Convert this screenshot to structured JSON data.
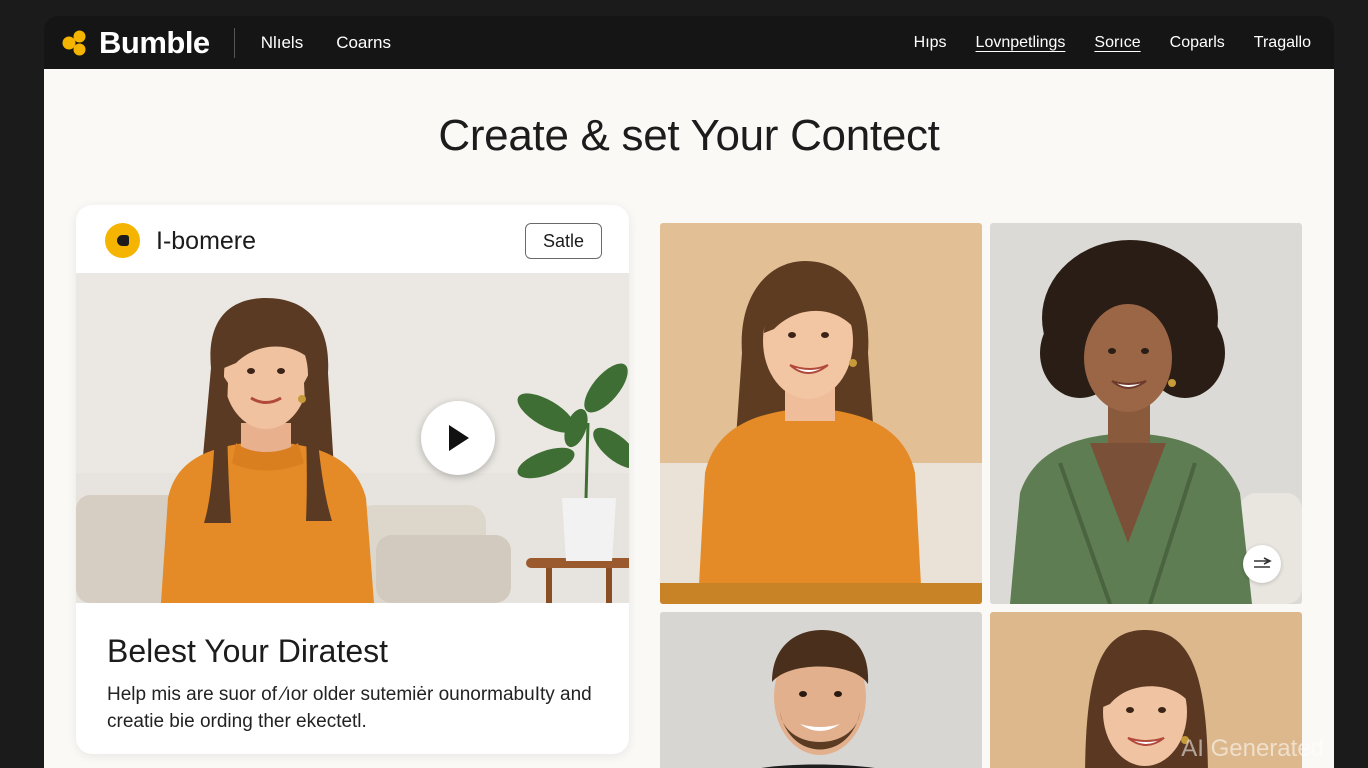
{
  "header": {
    "brand": "Bumble",
    "nav_left": [
      "Nlıels",
      "Coarns"
    ],
    "nav_right": [
      "Hıps",
      "Lovnpetlings",
      "Sorıce",
      "Coparls",
      "Tragallo"
    ]
  },
  "main": {
    "title": "Create & set Your Contect"
  },
  "card": {
    "name": "I-bomere",
    "save_label": "Satle",
    "title": "Belest Your Diratest",
    "description": "Help mis are suor of ⁄ıor older sutemiėr ounormabuIty and creatie bie ording ther ekectetl."
  },
  "watermark": "AI Generated",
  "colors": {
    "brand_accent": "#f4b400",
    "header_bg": "#151515",
    "page_bg": "#faf9f6"
  }
}
